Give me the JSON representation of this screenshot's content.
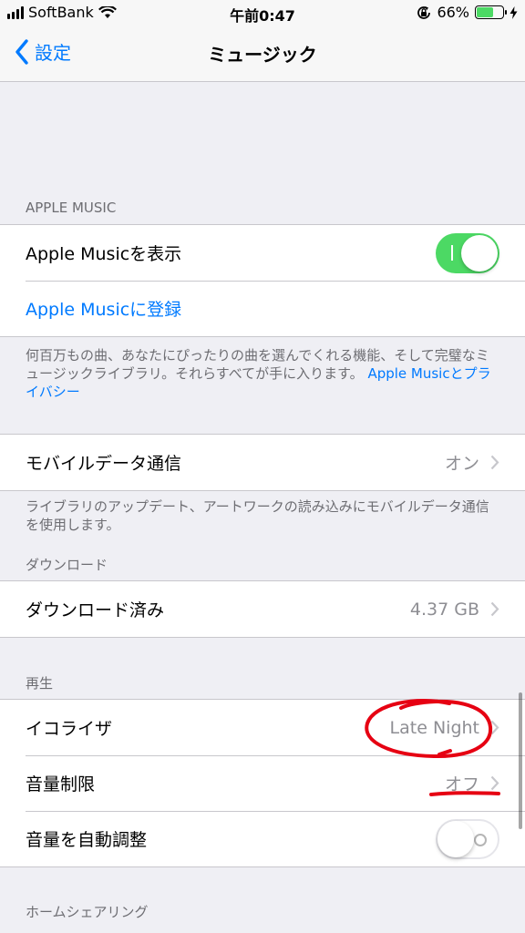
{
  "status_bar": {
    "carrier": "SoftBank",
    "time": "午前0:47",
    "battery_percent": "66%",
    "battery_level": 0.66
  },
  "nav": {
    "back_label": "設定",
    "title": "ミュージック"
  },
  "apple_music": {
    "header": "APPLE MUSIC",
    "show_label": "Apple Musicを表示",
    "show_enabled": true,
    "signup_label": "Apple Musicに登録",
    "footer_text": "何百万もの曲、あなたにぴったりの曲を選んでくれる機能、そして完璧なミュージックライブラリ。それらすべてが手に入ります。",
    "footer_link": "Apple Musicとプライバシー"
  },
  "cellular": {
    "label": "モバイルデータ通信",
    "value": "オン",
    "footer_text": "ライブラリのアップデート、アートワークの読み込みにモバイルデータ通信を使用します。"
  },
  "download": {
    "header": "ダウンロード",
    "label": "ダウンロード済み",
    "value": "4.37 GB"
  },
  "playback": {
    "header": "再生",
    "eq_label": "イコライザ",
    "eq_value": "Late Night",
    "volume_limit_label": "音量制限",
    "volume_limit_value": "オフ",
    "sound_check_label": "音量を自動調整",
    "sound_check_enabled": false
  },
  "home_sharing": {
    "header": "ホームシェアリング"
  },
  "colors": {
    "accent": "#007aff",
    "toggle_on": "#4cd964",
    "annotation": "#e60012"
  }
}
